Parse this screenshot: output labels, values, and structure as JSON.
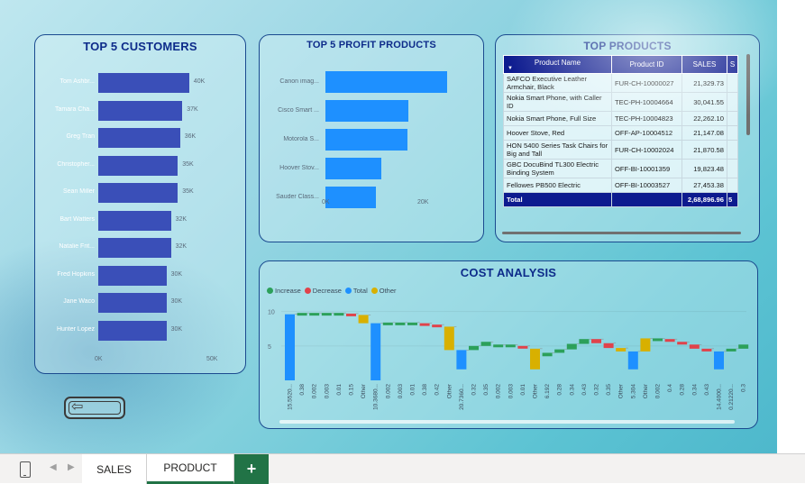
{
  "customers": {
    "title": "TOP 5 CUSTOMERS",
    "axis": [
      "0K",
      "50K"
    ],
    "items": [
      {
        "name": "Tom Ashbr...",
        "value": 40,
        "label": "40K"
      },
      {
        "name": "Tamara Cha...",
        "value": 37,
        "label": "37K"
      },
      {
        "name": "Greg Tran",
        "value": 36,
        "label": "36K"
      },
      {
        "name": "Christopher...",
        "value": 35,
        "label": "35K"
      },
      {
        "name": "Sean Miller",
        "value": 35,
        "label": "35K"
      },
      {
        "name": "Bart Watters",
        "value": 32,
        "label": "32K"
      },
      {
        "name": "Natalie Frit...",
        "value": 32,
        "label": "32K"
      },
      {
        "name": "Fred Hopkins",
        "value": 30,
        "label": "30K"
      },
      {
        "name": "Jane Waco",
        "value": 30,
        "label": "30K"
      },
      {
        "name": "Hunter Lopez",
        "value": 30,
        "label": "30K"
      }
    ]
  },
  "profit": {
    "title": "TOP 5 PROFIT PRODUCTS",
    "axis": [
      "0K",
      "20K"
    ],
    "items": [
      {
        "name": "Canon imag...",
        "value": 25.2
      },
      {
        "name": "Cisco Smart ...",
        "value": 17.2
      },
      {
        "name": "Motorola S...",
        "value": 17.0
      },
      {
        "name": "Hoover Stov...",
        "value": 11.6
      },
      {
        "name": "Sauder Class...",
        "value": 10.5
      }
    ]
  },
  "table": {
    "title": "TOP PRODUCTS",
    "headers": [
      "Product Name",
      "Product ID",
      "SALES",
      "S"
    ],
    "rows": [
      [
        "SAFCO Executive Leather Armchair, Black",
        "FUR-CH-10000027",
        "21,329.73"
      ],
      [
        "Nokia Smart Phone, with Caller ID",
        "TEC-PH-10004664",
        "30,041.55"
      ],
      [
        "Nokia Smart Phone, Full Size",
        "TEC-PH-10004823",
        "22,262.10"
      ],
      [
        "Hoover Stove, Red",
        "OFF-AP-10004512",
        "21,147.08"
      ],
      [
        "HON 5400 Series Task Chairs for Big and Tall",
        "FUR-CH-10002024",
        "21,870.58"
      ],
      [
        "GBC DocuBind TL300 Electric Binding System",
        "OFF-BI-10001359",
        "19,823.48"
      ],
      [
        "Fellowes PB500 Electric",
        "OFF-BI-10003527",
        "27,453.38"
      ]
    ],
    "total_label": "Total",
    "total_value": "2,68,896.96",
    "total_extra": "5"
  },
  "cost": {
    "title": "COST ANALYSIS",
    "legend": [
      {
        "label": "Increase",
        "color": "#2ca05a"
      },
      {
        "label": "Decrease",
        "color": "#e0434b"
      },
      {
        "label": "Total",
        "color": "#1e90ff"
      },
      {
        "label": "Other",
        "color": "#d8b000"
      }
    ],
    "y_ticks": [
      "10",
      "5"
    ]
  },
  "chart_data": {
    "type": "bar",
    "title": "COST ANALYSIS",
    "categories": [
      "15.5520...",
      "0.38",
      "0.002",
      "0.003",
      "0.01",
      "0.15",
      "Other",
      "10.3680...",
      "0.002",
      "0.003",
      "0.01",
      "0.38",
      "0.42",
      "Other",
      "20.7360...",
      "0.32",
      "0.35",
      "0.002",
      "0.003",
      "0.01",
      "Other",
      "6.192",
      "0.28",
      "0.34",
      "0.43",
      "0.32",
      "0.35",
      "Other",
      "5.304",
      "Other",
      "0.002",
      "0.4",
      "0.28",
      "0.34",
      "0.43",
      "14.4000...",
      "0.21220...",
      "0.3"
    ],
    "ylim": [
      0,
      11
    ],
    "y_ticks": [
      5,
      10
    ]
  },
  "tabs": {
    "sales": "SALES",
    "product": "PRODUCT",
    "add": "+"
  },
  "nav": {
    "prev": "◀",
    "next": "▶"
  },
  "back_arrow": "⇦"
}
